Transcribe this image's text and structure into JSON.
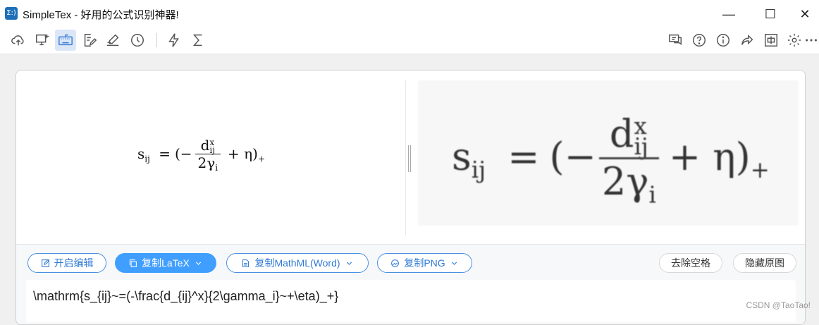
{
  "window": {
    "icon": "Σ:)",
    "title": "SimpleTex - 好用的公式识别神器!",
    "minimize": "—",
    "maximize": "☐",
    "close": "✕"
  },
  "toolbar": {
    "left_icons": [
      "cloud-upload-icon",
      "screen-capture-icon",
      "keyboard-icon",
      "edit-doc-icon",
      "handwrite-icon",
      "history-icon",
      "flash-icon",
      "sigma-icon"
    ],
    "right_icons": [
      "chat-icon",
      "help-icon",
      "info-icon",
      "share-icon",
      "translate-icon",
      "settings-icon",
      "more-icon"
    ]
  },
  "formula": {
    "lhs": "s",
    "lhs_sub": "ij",
    "eq": "=",
    "open": "(−",
    "num": "d",
    "num_sup": "x",
    "num_sub": "ij",
    "den": "2γ",
    "den_sub": "i",
    "plus_eta": "+ η)",
    "outer_sub": "+"
  },
  "buttons": {
    "edit": "开启编辑",
    "copy_latex": "复制LaTeX",
    "copy_mathml": "复制MathML(Word)",
    "copy_png": "复制PNG",
    "remove_spaces": "去除空格",
    "hide_original": "隐藏原图"
  },
  "latex": "\\mathrm{s_{ij}~=(-\\frac{d_{ij}^x}{2\\gamma_i}~+\\eta)_+}",
  "watermark": "CSDN @TaoTao!"
}
